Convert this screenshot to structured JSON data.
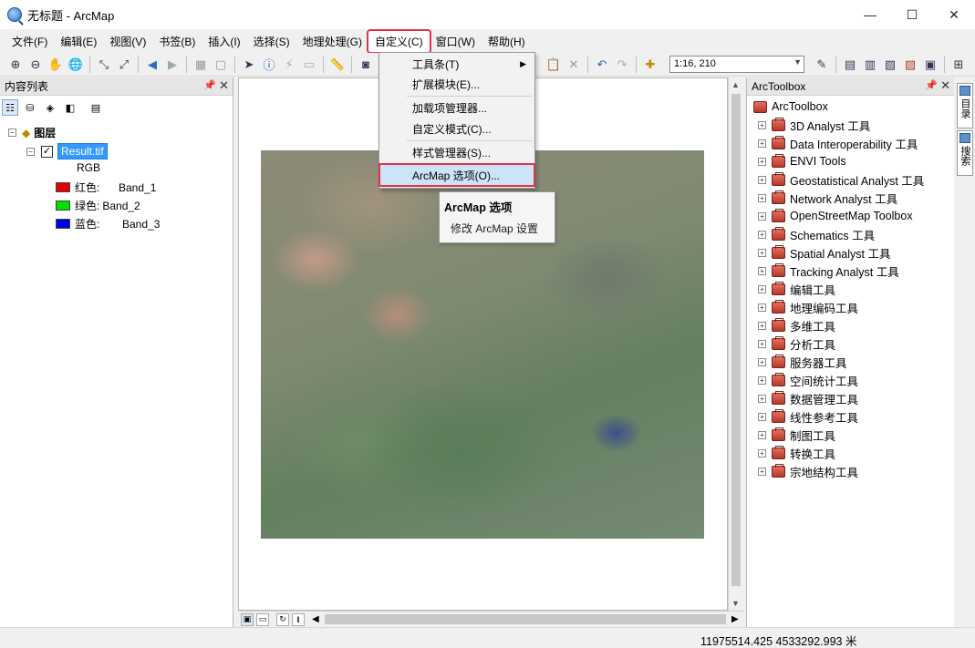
{
  "window": {
    "title": "无标题 - ArcMap",
    "minimize": "—",
    "maximize": "☐",
    "close": "✕"
  },
  "menubar": {
    "items": [
      "文件(F)",
      "编辑(E)",
      "视图(V)",
      "书签(B)",
      "插入(I)",
      "选择(S)",
      "地理处理(G)",
      "自定义(C)",
      "窗口(W)",
      "帮助(H)"
    ],
    "active_index": 7
  },
  "toolbar": {
    "scale": "1:16, 210"
  },
  "toc": {
    "title": "内容列表",
    "layers_label": "图层",
    "layer_name": "Result.tif",
    "rgb_label": "RGB",
    "bands": [
      {
        "label": "红色:",
        "band": "Band_1",
        "color": "#e00000"
      },
      {
        "label": "绿色:",
        "band": "Band_2",
        "color": "#00e000"
      },
      {
        "label": "蓝色:",
        "band": "Band_3",
        "color": "#0000e0"
      }
    ]
  },
  "customize_menu": {
    "items": [
      {
        "label": "工具条(T)",
        "submenu": true
      },
      {
        "label": "扩展模块(E)..."
      },
      {
        "label": "加载项管理器..."
      },
      {
        "label": "自定义模式(C)..."
      },
      {
        "label": "样式管理器(S)..."
      },
      {
        "label": "ArcMap 选项(O)...",
        "highlighted": true
      }
    ]
  },
  "tooltip": {
    "title": "ArcMap 选项",
    "body": "修改 ArcMap 设置"
  },
  "arctoolbox": {
    "panel_title": "ArcToolbox",
    "root": "ArcToolbox",
    "items": [
      "3D Analyst 工具",
      "Data Interoperability 工具",
      "ENVI Tools",
      "Geostatistical Analyst 工具",
      "Network Analyst 工具",
      "OpenStreetMap Toolbox",
      "Schematics 工具",
      "Spatial Analyst 工具",
      "Tracking Analyst 工具",
      "编辑工具",
      "地理编码工具",
      "多维工具",
      "分析工具",
      "服务器工具",
      "空间统计工具",
      "数据管理工具",
      "线性参考工具",
      "制图工具",
      "转换工具",
      "宗地结构工具"
    ]
  },
  "side_tabs": {
    "catalog": "目录",
    "search": "搜索"
  },
  "status": {
    "coordinates": "11975514.425  4533292.993 米"
  }
}
